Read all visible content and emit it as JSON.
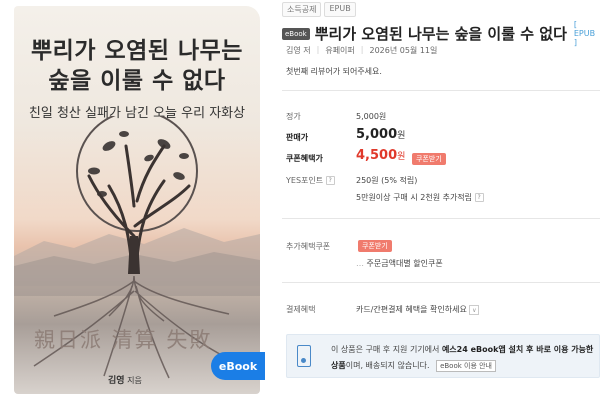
{
  "cover": {
    "title_line1": "뿌리가 오염된 나무는",
    "title_line2": "숲을 이룰 수 없다",
    "subtitle": "친일 청산 실패가 남긴 오늘 우리 자화상",
    "hanja": "親日派 清算 失敗",
    "author": "김영",
    "author_suffix": "지음",
    "ebook_label": "eBook"
  },
  "breadcrumbs": [
    "소득공제",
    "EPUB"
  ],
  "product": {
    "badge": "eBook",
    "title": "뿌리가 오염된 나무는 숲을 이룰 수 없다",
    "format_tag": "[ EPUB ]",
    "author": "김영 저",
    "publisher": "유페이퍼",
    "date": "2026년 05월 11일",
    "review_prompt": "첫번째 리뷰어가 되어주세요."
  },
  "pricing": {
    "list_label": "정가",
    "list_price": "5,000원",
    "sale_label": "판매가",
    "sale_price": "5,000",
    "sale_unit": "원",
    "coupon_label": "쿠폰혜택가",
    "coupon_price": "4,500",
    "coupon_unit": "원",
    "coupon_tag": "쿠폰받기",
    "points_label": "YES포인트",
    "points_value": "250원 (5% 적립)",
    "points_note": "5만원이상 구매 시 2천원 추가적립"
  },
  "extra": {
    "label": "추가혜택쿠폰",
    "tag": "쿠폰받기",
    "note": "주문금액대별 할인쿠폰"
  },
  "payment": {
    "label": "결제혜택",
    "value": "카드/간편결제 혜택을 확인하세요"
  },
  "notice": {
    "line1_pre": "이 상품은 구매 후 지원 기기에서 ",
    "line1_bold": "예스24 eBook앱 설치 후 바로 이용 가능한",
    "line2_bold": "상품",
    "line2_rest": "이며, 배송되지 않습니다.",
    "guide_button": "eBook 이용 안내"
  }
}
